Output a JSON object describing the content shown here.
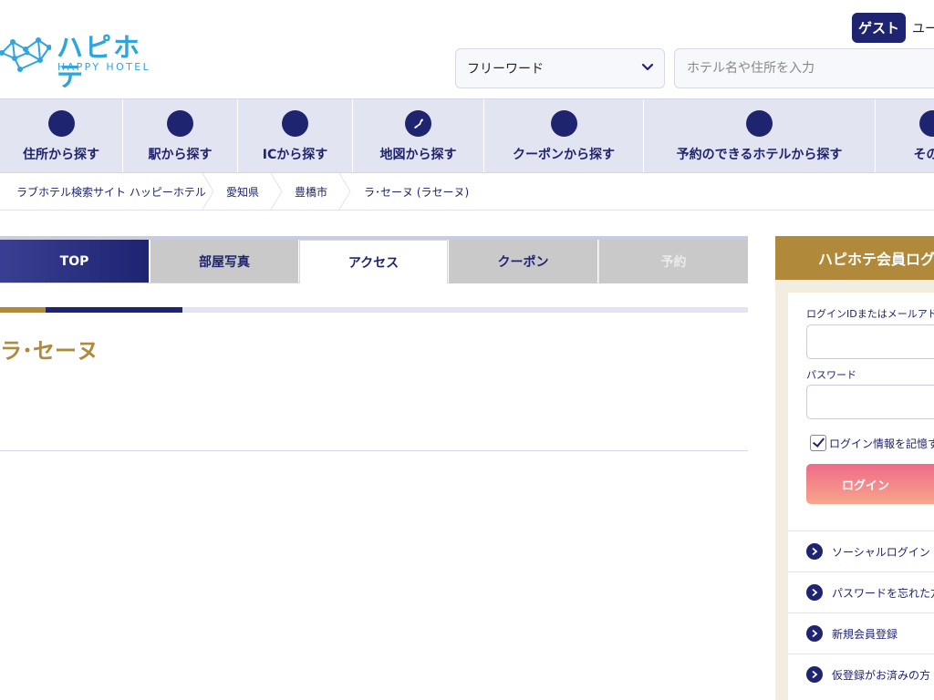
{
  "header": {
    "logo_jp": "ハピホテ",
    "logo_en": "HAPPY HOTEL",
    "guest_badge": "ゲスト",
    "user_label": "ユー",
    "search_type": "フリーワード",
    "search_placeholder": "ホテル名や住所を入力"
  },
  "nav": {
    "items": [
      {
        "label": "住所から探す",
        "icon": "circle-icon"
      },
      {
        "label": "駅から探す",
        "icon": "circle-icon"
      },
      {
        "label": "ICから探す",
        "icon": "circle-icon"
      },
      {
        "label": "地図から探す",
        "icon": "japan-map-icon"
      },
      {
        "label": "クーポンから探す",
        "icon": "circle-icon"
      },
      {
        "label": "予約のできるホテルから探す",
        "icon": "circle-icon"
      },
      {
        "label": "その他",
        "icon": "circle-icon"
      }
    ]
  },
  "breadcrumb": [
    "ラブホテル検索サイト ハッピーホテル",
    "愛知県",
    "豊橋市",
    "ラ･セーヌ (ラセーヌ)"
  ],
  "tabs": {
    "top": "TOP",
    "photos": "部屋写真",
    "access": "アクセス",
    "coupon": "クーポン",
    "reserve": "予約"
  },
  "hotel": {
    "name": "ラ･セーヌ"
  },
  "login": {
    "title": "ハピホテ会員ログ",
    "id_label": "ログインIDまたはメールアドレ",
    "password_label": "パスワード",
    "remember_label": "ログイン情報を記憶す",
    "button": "ログイン",
    "links": [
      "ソーシャルログイン",
      "パスワードを忘れた方",
      "新規会員登録",
      "仮登録がお済みの方"
    ]
  },
  "colors": {
    "navy": "#1e2470",
    "gold": "#b08a3a",
    "logo_blue": "#2fa4dd",
    "nav_bg": "#e3e4f1",
    "tab_gray": "#c9c9c9",
    "login_pink": "#ef6a8a"
  }
}
